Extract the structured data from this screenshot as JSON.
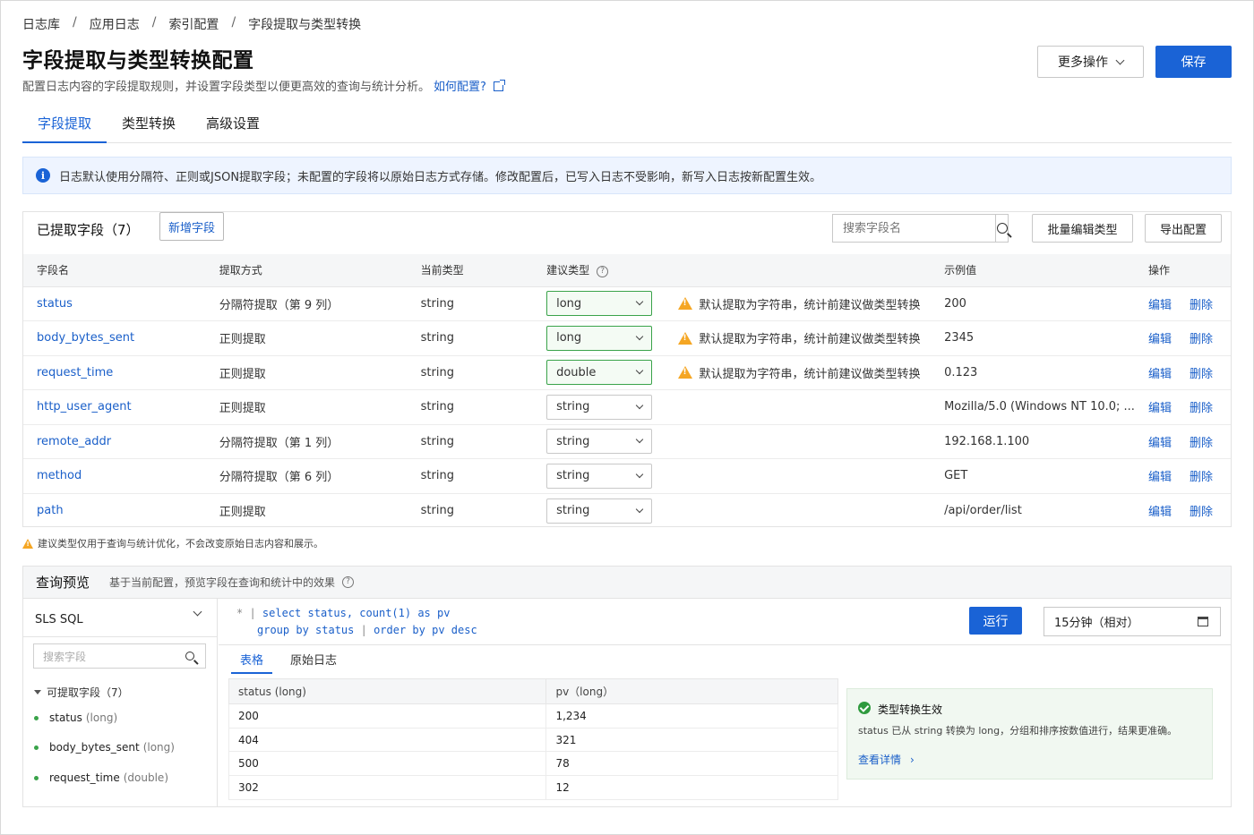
{
  "breadcrumb": [
    "日志库",
    "应用日志",
    "索引配置",
    "字段提取与类型转换"
  ],
  "breadcrumb_sep": "/",
  "page": {
    "title": "字段提取与类型转换配置",
    "description": "配置日志内容的字段提取规则，并设置字段类型以便更高效的查询与统计分析。",
    "help_link": "如何配置?"
  },
  "header_actions": {
    "more": "更多操作",
    "save": "保存"
  },
  "tabs": [
    {
      "label": "字段提取",
      "active": true
    },
    {
      "label": "类型转换",
      "active": false
    },
    {
      "label": "高级设置",
      "active": false
    }
  ],
  "notice": {
    "icon": "info-icon",
    "text": "日志默认使用分隔符、正则或JSON提取字段；未配置的字段将以原始日志方式存储。修改配置后，已写入日志不受影响，新写入日志按新配置生效。"
  },
  "fields_card": {
    "title": "已提取字段（7）",
    "add_button": "新增字段",
    "search_placeholder": "搜索字段名",
    "batch_button": "批量编辑类型",
    "export_button": "导出配置",
    "columns": {
      "name": "字段名",
      "method": "提取方式",
      "current_type": "当前类型",
      "suggested_type": "建议类型",
      "sample": "示例值",
      "ops": "操作"
    },
    "rows": [
      {
        "name": "status",
        "method": "分隔符提取（第 9 列）",
        "current": "string",
        "suggested": "long",
        "highlight": true,
        "warning": "默认提取为字符串，统计前建议做类型转换",
        "sample": "200",
        "edit": "编辑",
        "del": "删除"
      },
      {
        "name": "body_bytes_sent",
        "method": "正则提取",
        "current": "string",
        "suggested": "long",
        "highlight": true,
        "warning": "默认提取为字符串，统计前建议做类型转换",
        "sample": "2345",
        "edit": "编辑",
        "del": "删除"
      },
      {
        "name": "request_time",
        "method": "正则提取",
        "current": "string",
        "suggested": "double",
        "highlight": true,
        "warning": "默认提取为字符串，统计前建议做类型转换",
        "sample": "0.123",
        "edit": "编辑",
        "del": "删除"
      },
      {
        "name": "http_user_agent",
        "method": "正则提取",
        "current": "string",
        "suggested": "string",
        "highlight": false,
        "warning": "",
        "sample": "Mozilla/5.0 (Windows NT 10.0; ...",
        "edit": "编辑",
        "del": "删除"
      },
      {
        "name": "remote_addr",
        "method": "分隔符提取（第 1 列）",
        "current": "string",
        "suggested": "string",
        "highlight": false,
        "warning": "",
        "sample": "192.168.1.100",
        "edit": "编辑",
        "del": "删除"
      },
      {
        "name": "method",
        "method": "分隔符提取（第 6 列）",
        "current": "string",
        "suggested": "string",
        "highlight": false,
        "warning": "",
        "sample": "GET",
        "edit": "编辑",
        "del": "删除"
      },
      {
        "name": "path",
        "method": "正则提取",
        "current": "string",
        "suggested": "string",
        "highlight": false,
        "warning": "",
        "sample": "/api/order/list",
        "edit": "编辑",
        "del": "删除"
      }
    ]
  },
  "footnote": "建议类型仅用于查询与统计优化，不会改变原始日志内容和展示。",
  "preview": {
    "title": "查询预览",
    "description": "基于当前配置，预览字段在查询和统计中的效果",
    "query_lang": "SLS SQL",
    "field_search_placeholder": "搜索字段",
    "tree_root": "可提取字段（7）",
    "tree_items": [
      {
        "name": "status",
        "type": "(long)"
      },
      {
        "name": "body_bytes_sent",
        "type": "(long)"
      },
      {
        "name": "request_time",
        "type": "(double)"
      }
    ],
    "code_line1": {
      "prefix": "*  |",
      "body": "select status, count(1) as pv"
    },
    "code_line2": {
      "body1": "group by status",
      "sep": "|",
      "body2": "order by pv desc"
    },
    "run_button": "运行",
    "time_range": "15分钟（相对）",
    "subtabs": [
      {
        "label": "表格",
        "active": true
      },
      {
        "label": "原始日志",
        "active": false
      }
    ],
    "result_columns": [
      "status (long)",
      "pv（long）"
    ],
    "result_rows": [
      [
        "200",
        "1,234"
      ],
      [
        "404",
        "321"
      ],
      [
        "500",
        "78"
      ],
      [
        "302",
        "12"
      ]
    ],
    "result_card": {
      "title": "类型转换生效",
      "description": "status 已从 string 转换为 long，分组和排序按数值进行，结果更准确。",
      "link": "查看详情"
    }
  },
  "colors": {
    "accent": "#1a63d6",
    "link": "#1a5fc9",
    "warning": "#f5a623",
    "success": "#3aa34a"
  }
}
